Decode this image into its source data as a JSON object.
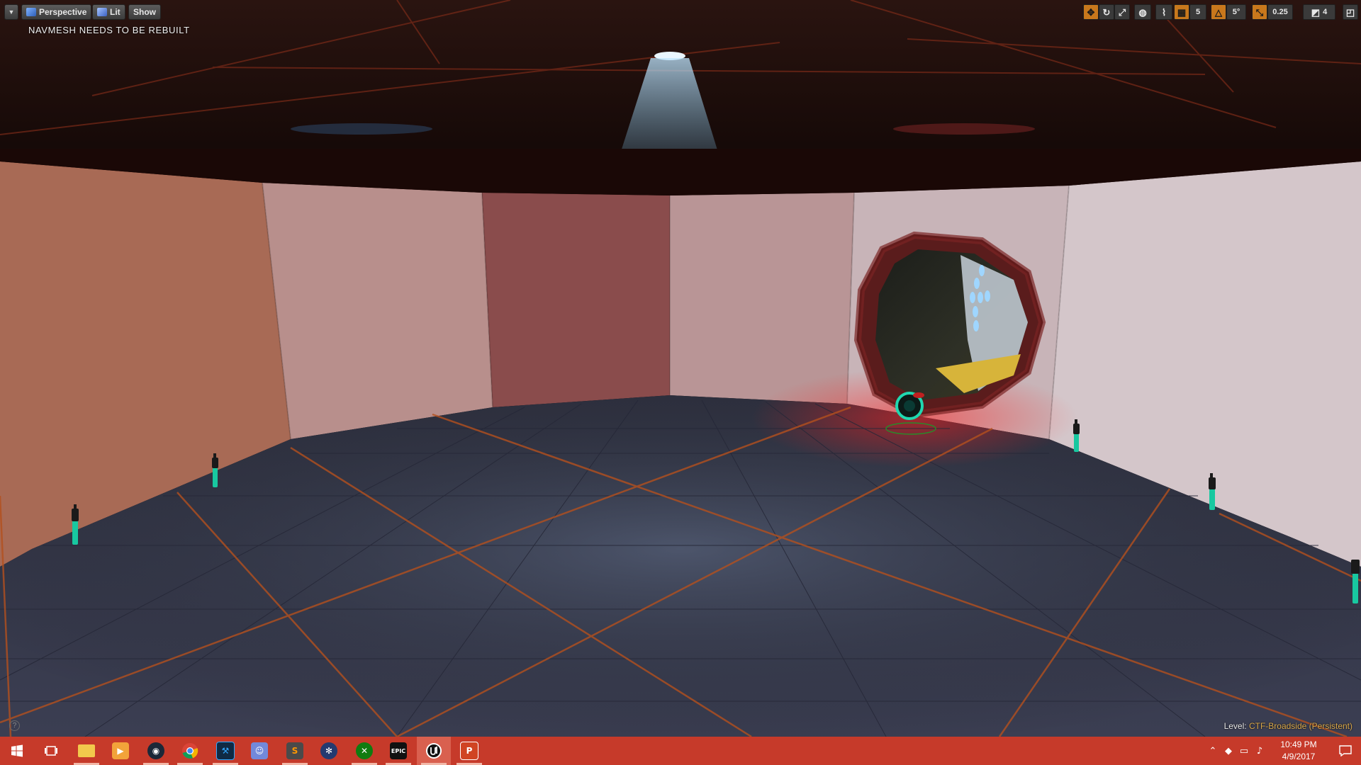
{
  "viewport": {
    "toolbar": {
      "menu_icon": "chevron-down-icon",
      "perspective_label": "Perspective",
      "lit_label": "Lit",
      "show_label": "Show"
    },
    "right_toolbar": {
      "grid_snap_value": "5",
      "rotation_snap_value": "5°",
      "scale_snap_value": "0.25",
      "camera_speed_value": "4"
    },
    "warning_text": "NAVMESH NEEDS TO BE REBUILT",
    "level_label": "Level:",
    "level_name": "CTF-Broadside (Persistent)",
    "help_glyph": "?"
  },
  "taskbar": {
    "apps": [
      {
        "name": "start",
        "icon": "windows-icon"
      },
      {
        "name": "task-view",
        "icon": "task-view-icon"
      },
      {
        "name": "file-explorer",
        "icon": "folder-icon"
      },
      {
        "name": "media-player",
        "icon": "media-icon"
      },
      {
        "name": "steam",
        "icon": "steam-icon"
      },
      {
        "name": "chrome",
        "icon": "chrome-icon"
      },
      {
        "name": "photoshop",
        "icon": "photoshop-icon"
      },
      {
        "name": "discord",
        "icon": "discord-icon"
      },
      {
        "name": "sublime",
        "icon": "sublime-icon"
      },
      {
        "name": "unknown-app",
        "icon": "wheel-icon"
      },
      {
        "name": "xbox",
        "icon": "xbox-icon"
      },
      {
        "name": "epic-games",
        "icon": "epic-icon",
        "label": "EPIC"
      },
      {
        "name": "unreal-engine",
        "icon": "unreal-icon"
      },
      {
        "name": "powerpoint",
        "icon": "powerpoint-icon",
        "label": "P"
      }
    ],
    "clock_time": "10:49 PM",
    "clock_date": "4/9/2017"
  },
  "colors": {
    "taskbar": "#c63a2a",
    "accent_orange": "#c8781c",
    "light_blue": "#46b4ff",
    "light_red": "#ff3030"
  }
}
